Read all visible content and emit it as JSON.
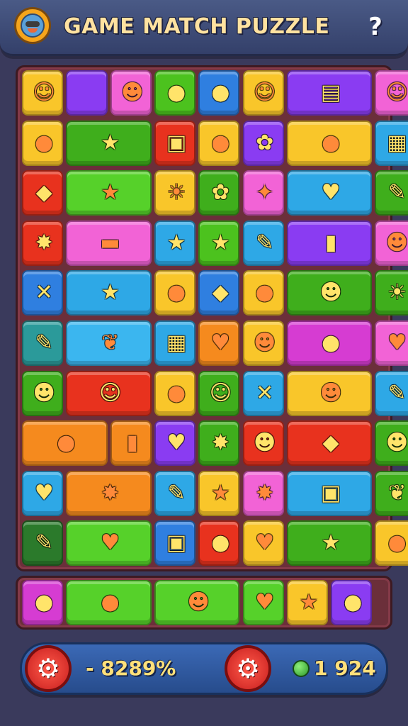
{
  "header": {
    "title": "GAME MATCH PUZZLE",
    "help_label": "?",
    "logo_icon": "monster-face-icon"
  },
  "board": {
    "rows": [
      [
        {
          "span": 1,
          "color": "#f9c62a",
          "icon": "smile-face-icon",
          "glyph": "☺"
        },
        {
          "span": 1,
          "color": "#8a3cf2",
          "icon": "none",
          "glyph": ""
        },
        {
          "span": 1,
          "color": "#f263d6",
          "icon": "cookie-face-icon",
          "glyph": "☻"
        },
        {
          "span": 1,
          "color": "#4cc21e",
          "icon": "orange-fruit-icon",
          "glyph": "●"
        },
        {
          "span": 1,
          "color": "#2f7fe0",
          "icon": "pink-ball-icon",
          "glyph": "●"
        },
        {
          "span": 1,
          "color": "#f9c62a",
          "icon": "smile-face-icon",
          "glyph": "☺"
        },
        {
          "span": 2,
          "color": "#8a3cf2",
          "icon": "clipboard-icon",
          "glyph": "▤"
        },
        {
          "span": 1,
          "color": "#f263d6",
          "icon": "smile-face-icon",
          "glyph": "☺"
        }
      ],
      [
        {
          "span": 1,
          "color": "#f9c62a",
          "icon": "lollipop-icon",
          "glyph": "●"
        },
        {
          "span": 2,
          "color": "#3fae1c",
          "icon": "star-icon",
          "glyph": "★"
        },
        {
          "span": 1,
          "color": "#e8321e",
          "icon": "cheese-icon",
          "glyph": "▣"
        },
        {
          "span": 1,
          "color": "#f9c62a",
          "icon": "lollipop-icon",
          "glyph": "●"
        },
        {
          "span": 1,
          "color": "#8a3cf2",
          "icon": "puzzle-piece-icon",
          "glyph": "✿"
        },
        {
          "span": 2,
          "color": "#f9c62a",
          "icon": "candy-icon",
          "glyph": "●"
        },
        {
          "span": 1,
          "color": "#2ea8e6",
          "icon": "bandage-icon",
          "glyph": "▦"
        }
      ],
      [
        {
          "span": 1,
          "color": "#e8321e",
          "icon": "gift-box-icon",
          "glyph": "◆"
        },
        {
          "span": 2,
          "color": "#56d12a",
          "icon": "star-icon",
          "glyph": "★"
        },
        {
          "span": 1,
          "color": "#f9c62a",
          "icon": "sun-face-icon",
          "glyph": "☀"
        },
        {
          "span": 1,
          "color": "#3fae1c",
          "icon": "puzzle-piece-icon",
          "glyph": "✿"
        },
        {
          "span": 1,
          "color": "#f263d6",
          "icon": "fairy-icon",
          "glyph": "✦"
        },
        {
          "span": 2,
          "color": "#2ea8e6",
          "icon": "heart-icon",
          "glyph": "♥"
        },
        {
          "span": 1,
          "color": "#3fae1c",
          "icon": "brush-icon",
          "glyph": "✎"
        }
      ],
      [
        {
          "span": 1,
          "color": "#e8321e",
          "icon": "splat-icon",
          "glyph": "✸"
        },
        {
          "span": 2,
          "color": "#f263d6",
          "icon": "butter-icon",
          "glyph": "▬"
        },
        {
          "span": 1,
          "color": "#2ea8e6",
          "icon": "star-icon",
          "glyph": "★"
        },
        {
          "span": 1,
          "color": "#4cc21e",
          "icon": "star-icon",
          "glyph": "★"
        },
        {
          "span": 1,
          "color": "#2ea8e6",
          "icon": "pencil-icon",
          "glyph": "✎"
        },
        {
          "span": 2,
          "color": "#8a3cf2",
          "icon": "bottle-icon",
          "glyph": "▮"
        },
        {
          "span": 1,
          "color": "#f263d6",
          "icon": "monster-face-icon",
          "glyph": "☻"
        }
      ],
      [
        {
          "span": 1,
          "color": "#2f7fe0",
          "icon": "pickaxe-icon",
          "glyph": "✕"
        },
        {
          "span": 2,
          "color": "#2ea8e6",
          "icon": "star-icon",
          "glyph": "★"
        },
        {
          "span": 1,
          "color": "#f9c62a",
          "icon": "tomato-icon",
          "glyph": "●"
        },
        {
          "span": 1,
          "color": "#2f7fe0",
          "icon": "bow-icon",
          "glyph": "◆"
        },
        {
          "span": 1,
          "color": "#f9c62a",
          "icon": "chat-bubble-icon",
          "glyph": "●"
        },
        {
          "span": 2,
          "color": "#3fae1c",
          "icon": "monster-face-icon",
          "glyph": "☻"
        },
        {
          "span": 1,
          "color": "#3fae1c",
          "icon": "sun-face-icon",
          "glyph": "☀"
        }
      ],
      [
        {
          "span": 1,
          "color": "#2b9a9a",
          "icon": "brush-icon",
          "glyph": "✎"
        },
        {
          "span": 2,
          "color": "#3bb6ef",
          "icon": "leaf-icon",
          "glyph": "❦"
        },
        {
          "span": 1,
          "color": "#2ea8e6",
          "icon": "battery-icon",
          "glyph": "▦"
        },
        {
          "span": 1,
          "color": "#f58a1e",
          "icon": "heart-icon",
          "glyph": "♥"
        },
        {
          "span": 1,
          "color": "#f9c62a",
          "icon": "monster-face-icon",
          "glyph": "☻"
        },
        {
          "span": 2,
          "color": "#d63cd2",
          "icon": "fruit-icon",
          "glyph": "●"
        },
        {
          "span": 1,
          "color": "#f263d6",
          "icon": "heart-icon",
          "glyph": "♥"
        }
      ],
      [
        {
          "span": 1,
          "color": "#3fae1c",
          "icon": "blob-face-icon",
          "glyph": "☻"
        },
        {
          "span": 2,
          "color": "#e8321e",
          "icon": "cookie-face-icon",
          "glyph": "☺"
        },
        {
          "span": 1,
          "color": "#f9c62a",
          "icon": "pepper-icon",
          "glyph": "●"
        },
        {
          "span": 1,
          "color": "#3fae1c",
          "icon": "smile-face-icon",
          "glyph": "☺"
        },
        {
          "span": 1,
          "color": "#2ea8e6",
          "icon": "pickaxe-icon",
          "glyph": "✕"
        },
        {
          "span": 2,
          "color": "#f9c62a",
          "icon": "monster-face-icon",
          "glyph": "☻"
        },
        {
          "span": 1,
          "color": "#2ea8e6",
          "icon": "crayon-icon",
          "glyph": "✎"
        }
      ],
      [
        {
          "span": 2,
          "color": "#f58a1e",
          "icon": "ornament-icon",
          "glyph": "●"
        },
        {
          "span": 1,
          "color": "#f58a1e",
          "icon": "ice-pop-icon",
          "glyph": "▮"
        },
        {
          "span": 1,
          "color": "#8a3cf2",
          "icon": "heart-icon",
          "glyph": "♥"
        },
        {
          "span": 1,
          "color": "#3fae1c",
          "icon": "splat-icon",
          "glyph": "✸"
        },
        {
          "span": 1,
          "color": "#e8321e",
          "icon": "monster-face-icon",
          "glyph": "☻"
        },
        {
          "span": 2,
          "color": "#e8321e",
          "icon": "kite-icon",
          "glyph": "◆"
        },
        {
          "span": 1,
          "color": "#3fae1c",
          "icon": "cat-face-icon",
          "glyph": "☻"
        }
      ],
      [
        {
          "span": 1,
          "color": "#2ea8e6",
          "icon": "heart-icon",
          "glyph": "♥"
        },
        {
          "span": 2,
          "color": "#f58a1e",
          "icon": "splat-icon",
          "glyph": "✸"
        },
        {
          "span": 1,
          "color": "#2ea8e6",
          "icon": "brush-icon",
          "glyph": "✎"
        },
        {
          "span": 1,
          "color": "#f9c62a",
          "icon": "star-icon",
          "glyph": "★"
        },
        {
          "span": 1,
          "color": "#f263d6",
          "icon": "sheriff-badge-icon",
          "glyph": "✸"
        },
        {
          "span": 2,
          "color": "#2ea8e6",
          "icon": "gift-bag-icon",
          "glyph": "▣"
        },
        {
          "span": 1,
          "color": "#3fae1c",
          "icon": "feather-icon",
          "glyph": "❦"
        }
      ],
      [
        {
          "span": 1,
          "color": "#2b7a2b",
          "icon": "crayon-icon",
          "glyph": "✎"
        },
        {
          "span": 2,
          "color": "#56d12a",
          "icon": "candy-icon",
          "glyph": "♥"
        },
        {
          "span": 1,
          "color": "#2f7fe0",
          "icon": "gift-box-icon",
          "glyph": "▣"
        },
        {
          "span": 1,
          "color": "#e8321e",
          "icon": "lollipop-icon",
          "glyph": "●"
        },
        {
          "span": 1,
          "color": "#f9c62a",
          "icon": "heart-icon",
          "glyph": "♥"
        },
        {
          "span": 2,
          "color": "#3fae1c",
          "icon": "star-icon",
          "glyph": "★"
        },
        {
          "span": 1,
          "color": "#f9c62a",
          "icon": "lollipop-icon",
          "glyph": "●"
        }
      ]
    ],
    "tray": [
      {
        "span": 1,
        "color": "#d63cd2",
        "icon": "lollipop-icon",
        "glyph": "●"
      },
      {
        "span": 2,
        "color": "#56d12a",
        "icon": "chat-bubble-icon",
        "glyph": "●"
      },
      {
        "span": 2,
        "color": "#56d12a",
        "icon": "monster-face-icon",
        "glyph": "☻"
      },
      {
        "span": 1,
        "color": "#56d12a",
        "icon": "heart-icon",
        "glyph": "♥"
      },
      {
        "span": 1,
        "color": "#f9c62a",
        "icon": "star-icon",
        "glyph": "★"
      },
      {
        "span": 1,
        "color": "#8a3cf2",
        "icon": "lollipop-icon",
        "glyph": "●"
      }
    ]
  },
  "footer": {
    "left_button_icon": "gear-icon",
    "left_value": "- 8289%",
    "right_button_icon": "gear-icon",
    "coin_icon": "green-gem-icon",
    "right_value": "1 924"
  },
  "colors": {
    "background": "#3a3a5c",
    "board_frame": "#6b2f3a",
    "header": "#3e4b78",
    "footer": "#2f5aa0",
    "accent_red": "#e0281e",
    "score_yellow": "#ffe07a"
  }
}
